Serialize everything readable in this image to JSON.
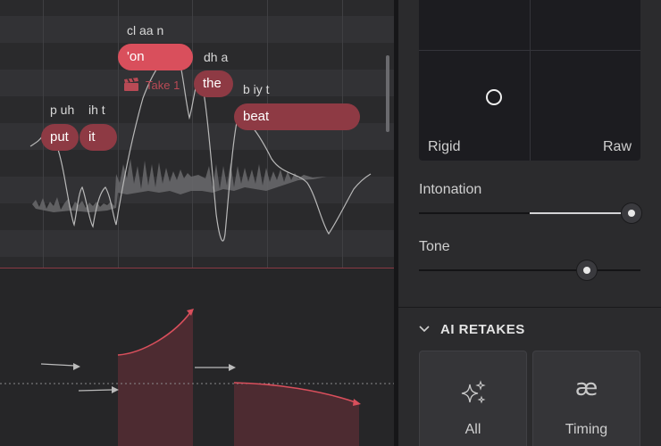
{
  "editor": {
    "notes": [
      {
        "text": "put",
        "state": "dark"
      },
      {
        "text": "it",
        "state": "dark"
      },
      {
        "text": "'on",
        "state": "active"
      },
      {
        "text": "the",
        "state": "dark"
      },
      {
        "text": "beat",
        "state": "dark"
      }
    ],
    "phonemes": [
      "p uh",
      "ih t",
      "cl aa n",
      "dh a",
      "b iy t"
    ],
    "take_label": "Take 1",
    "take_icon": "clapperboard-icon"
  },
  "panel": {
    "pad": {
      "left_label": "Rigid",
      "right_label": "Raw"
    },
    "sliders": [
      {
        "label": "Intonation",
        "value_fraction": 0.96
      },
      {
        "label": "Tone",
        "value_fraction": 0.76
      }
    ],
    "ai_retakes": {
      "title": "AI RETAKES",
      "buttons": [
        {
          "label": "All",
          "icon": "sparkles-icon"
        },
        {
          "label": "Timing",
          "icon": "ae-ligature-icon",
          "glyph": "æ"
        }
      ]
    }
  },
  "colors": {
    "accent": "#d94f5c",
    "note_dark": "#8e3a44",
    "background": "#2a2a2c"
  }
}
